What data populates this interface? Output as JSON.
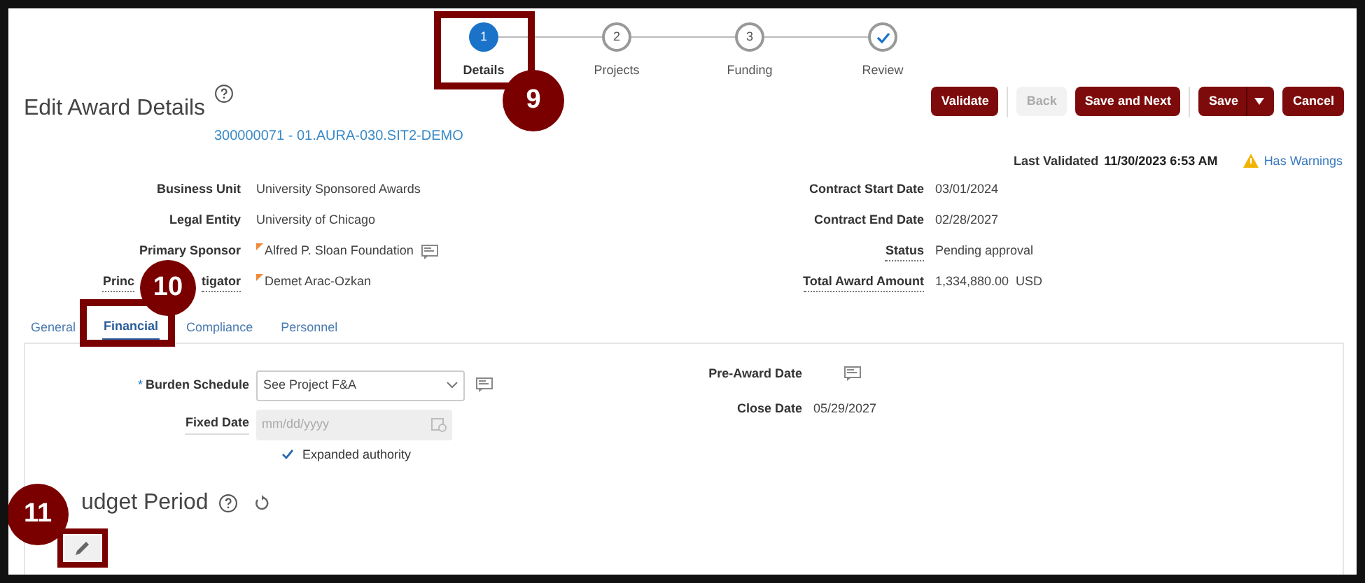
{
  "steps": [
    {
      "kind": "number",
      "number": "1",
      "label": "Details",
      "selected": true
    },
    {
      "kind": "number",
      "number": "2",
      "label": "Projects",
      "selected": false
    },
    {
      "kind": "number",
      "number": "3",
      "label": "Funding",
      "selected": false
    },
    {
      "kind": "check",
      "label": "Review",
      "selected": false
    }
  ],
  "page": {
    "title": "Edit Award Details",
    "award_link": "300000071 - 01.AURA-030.SIT2-DEMO"
  },
  "buttons": [
    {
      "label": "Validate",
      "disabled": false,
      "has_menu": false
    },
    {
      "label": "Back",
      "disabled": true,
      "has_menu": false
    },
    {
      "label": "Save and Next",
      "disabled": false,
      "has_menu": false
    },
    {
      "label": "Save",
      "disabled": false,
      "has_menu": true
    },
    {
      "label": "Cancel",
      "disabled": false,
      "has_menu": false
    }
  ],
  "last_validated": {
    "label": "Last Validated",
    "value": "11/30/2023 6:53 AM",
    "warning": "Has Warnings"
  },
  "fields_left": [
    {
      "label_parts": [
        "Business Unit"
      ],
      "value": "University Sponsored Awards",
      "underlined": false,
      "flag": false,
      "contact_icon": false
    },
    {
      "label_parts": [
        "Legal Entity"
      ],
      "value": "University of Chicago",
      "underlined": false,
      "flag": false,
      "contact_icon": false
    },
    {
      "label_parts": [
        "Primary Sponsor"
      ],
      "value": "Alfred P. Sloan Foundation",
      "underlined": false,
      "flag": true,
      "contact_icon": true
    },
    {
      "label_parts": [
        "Princ",
        "tigator"
      ],
      "value": "Demet Arac-Ozkan",
      "underlined": true,
      "flag": true,
      "contact_icon": false
    }
  ],
  "fields_right": [
    {
      "label": "Contract Start Date",
      "value": "03/01/2024",
      "underlined": false
    },
    {
      "label": "Contract End Date",
      "value": "02/28/2027",
      "underlined": false
    },
    {
      "label": "Status",
      "value": "Pending approval",
      "underlined": true
    },
    {
      "label": "Total Award Amount",
      "value": "1,334,880.00  USD",
      "underlined": true
    }
  ],
  "tabs": [
    {
      "label": "General",
      "selected": false
    },
    {
      "label": "Financial",
      "selected": true
    },
    {
      "label": "Compliance",
      "selected": false
    },
    {
      "label": "Personnel",
      "selected": false
    }
  ],
  "financial": {
    "burden_schedule": {
      "label": "Burden Schedule",
      "required_mark": "*",
      "value": "See Project F&A"
    },
    "fixed_date": {
      "label": "Fixed Date",
      "placeholder": "mm/dd/yyyy",
      "disabled": true
    },
    "expanded_authority": {
      "label": "Expanded authority",
      "checked": true
    },
    "pre_award_date": {
      "label": "Pre-Award Date"
    },
    "close_date": {
      "label": "Close Date",
      "value": "05/29/2027"
    }
  },
  "budget_period": {
    "title": "udget Period"
  },
  "callouts": [
    {
      "number": "9"
    },
    {
      "number": "10"
    },
    {
      "number": "11"
    }
  ]
}
